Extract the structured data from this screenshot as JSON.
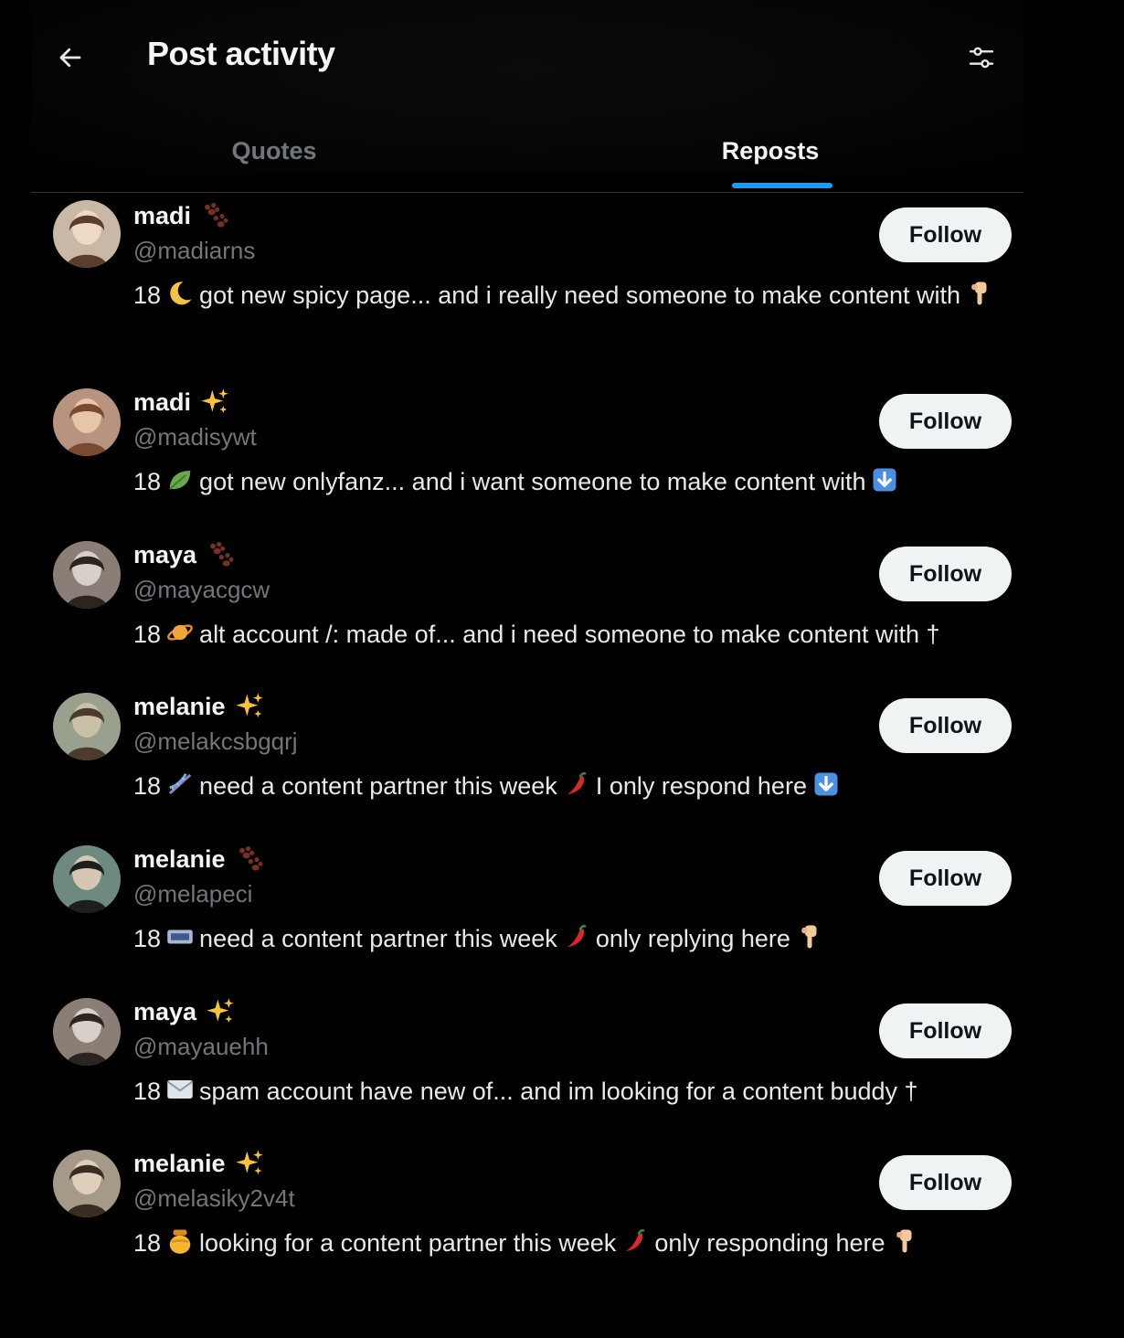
{
  "header": {
    "title": "Post activity",
    "back_icon": "arrow-left-icon",
    "filter_icon": "sliders-icon"
  },
  "tabs": [
    {
      "label": "Quotes",
      "selected": false
    },
    {
      "label": "Reposts",
      "selected": true
    }
  ],
  "colors": {
    "background": "#000000",
    "accent": "#1d9bf0",
    "muted_text": "#71767b",
    "button_bg": "#eff3f4"
  },
  "users": [
    {
      "name": "madi",
      "badge": "paw-prints-icon",
      "handle": "@madiarns",
      "follow_label": "Follow",
      "bio": [
        {
          "t": "18"
        },
        {
          "e": "crescent-moon-icon"
        },
        {
          "t": "got new spicy page... and i really need someone to make content with"
        },
        {
          "e": "point-down-icon"
        }
      ]
    },
    {
      "name": "madi",
      "badge": "sparkles-icon",
      "handle": "@madisywt",
      "follow_label": "Follow",
      "bio": [
        {
          "t": "18"
        },
        {
          "e": "leaf-icon"
        },
        {
          "t": "got new onlyfanz... and i want someone to make content with"
        },
        {
          "e": "down-arrow-box-icon"
        }
      ]
    },
    {
      "name": "maya",
      "badge": "paw-prints-icon",
      "handle": "@mayacgcw",
      "follow_label": "Follow",
      "bio": [
        {
          "t": "18"
        },
        {
          "e": "planet-icon"
        },
        {
          "t": "alt account /: made of... and i need someone to make content with †"
        }
      ]
    },
    {
      "name": "melanie",
      "badge": "sparkles-icon",
      "handle": "@melakcsbgqrj",
      "follow_label": "Follow",
      "bio": [
        {
          "t": "18"
        },
        {
          "e": "dna-icon"
        },
        {
          "t": "need a content partner this week"
        },
        {
          "e": "chili-pepper-icon"
        },
        {
          "t": "I only respond here"
        },
        {
          "e": "down-arrow-box-icon"
        }
      ]
    },
    {
      "name": "melanie",
      "badge": "paw-prints-icon",
      "handle": "@melapeci",
      "follow_label": "Follow",
      "bio": [
        {
          "t": "18"
        },
        {
          "e": "ticket-icon"
        },
        {
          "t": "need a content partner this week"
        },
        {
          "e": "chili-pepper-icon"
        },
        {
          "t": "only replying here"
        },
        {
          "e": "point-down-icon"
        }
      ]
    },
    {
      "name": "maya",
      "badge": "sparkles-icon",
      "handle": "@mayauehh",
      "follow_label": "Follow",
      "bio": [
        {
          "t": "18"
        },
        {
          "e": "envelope-icon"
        },
        {
          "t": "spam account have new of... and im looking for a content buddy †"
        }
      ]
    },
    {
      "name": "melanie",
      "badge": "sparkles-icon",
      "handle": "@melasiky2v4t",
      "follow_label": "Follow",
      "bio": [
        {
          "t": "18"
        },
        {
          "e": "honey-pot-icon"
        },
        {
          "t": "looking for a content partner this week"
        },
        {
          "e": "chili-pepper-icon"
        },
        {
          "t": "only responding here"
        },
        {
          "e": "point-down-icon"
        }
      ]
    }
  ]
}
